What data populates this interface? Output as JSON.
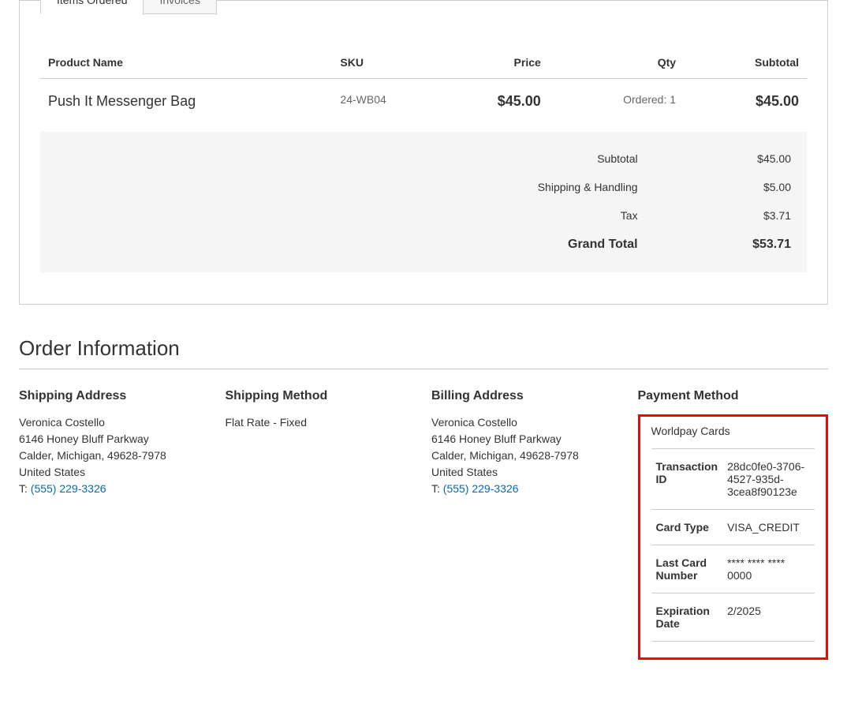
{
  "tabs": {
    "items_ordered": "Items Ordered",
    "invoices": "Invoices"
  },
  "items_table": {
    "headers": {
      "product_name": "Product Name",
      "sku": "SKU",
      "price": "Price",
      "qty": "Qty",
      "subtotal": "Subtotal"
    },
    "rows": [
      {
        "name": "Push It Messenger Bag",
        "sku": "24-WB04",
        "price": "$45.00",
        "qty": "Ordered: 1",
        "subtotal": "$45.00"
      }
    ]
  },
  "totals": {
    "subtotal_label": "Subtotal",
    "subtotal_value": "$45.00",
    "shipping_label": "Shipping & Handling",
    "shipping_value": "$5.00",
    "tax_label": "Tax",
    "tax_value": "$3.71",
    "grand_label": "Grand Total",
    "grand_value": "$53.71"
  },
  "section_title": "Order Information",
  "shipping_address": {
    "title": "Shipping Address",
    "name": "Veronica Costello",
    "street": "6146 Honey Bluff Parkway",
    "city": "Calder, Michigan, 49628-7978",
    "country": "United States",
    "phone_prefix": "T: ",
    "phone": "(555) 229-3326"
  },
  "shipping_method": {
    "title": "Shipping Method",
    "value": "Flat Rate - Fixed"
  },
  "billing_address": {
    "title": "Billing Address",
    "name": "Veronica Costello",
    "street": "6146 Honey Bluff Parkway",
    "city": "Calder, Michigan, 49628-7978",
    "country": "United States",
    "phone_prefix": "T: ",
    "phone": "(555) 229-3326"
  },
  "payment": {
    "title": "Payment Method",
    "method_name": "Worldpay Cards",
    "details": [
      {
        "label": "Transaction ID",
        "value": "28dc0fe0-3706-4527-935d-3cea8f90123e"
      },
      {
        "label": "Card Type",
        "value": "VISA_CREDIT"
      },
      {
        "label": "Last Card Number",
        "value": "**** **** **** 0000"
      },
      {
        "label": "Expiration Date",
        "value": "2/2025"
      }
    ]
  }
}
